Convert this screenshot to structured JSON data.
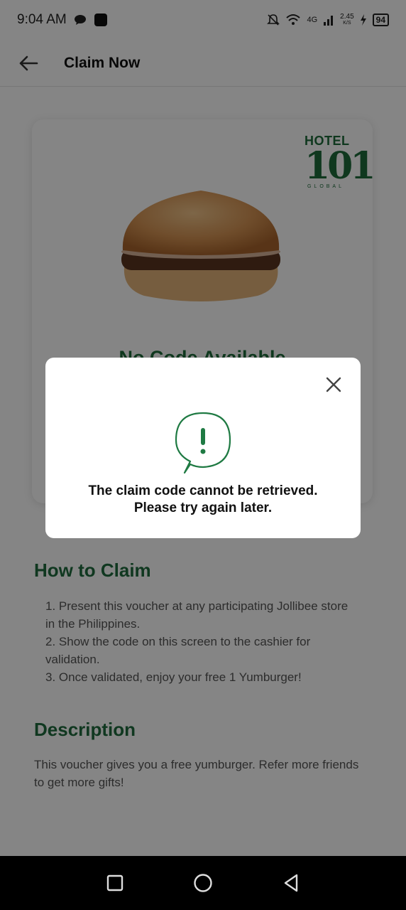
{
  "status_bar": {
    "time": "9:04 AM",
    "network": "4G",
    "speed_value": "2.45",
    "speed_unit": "K/S",
    "battery": "94"
  },
  "app_bar": {
    "title": "Claim Now",
    "back_icon": "arrow-left-icon"
  },
  "voucher": {
    "logo_top": "HOTEL",
    "logo_mid": "101",
    "logo_bottom": "GLOBAL",
    "code_status": "No Code Available"
  },
  "how_to_claim": {
    "title": "How to Claim",
    "steps": [
      "1. Present this voucher at any participating Jollibee store in the Philippines.",
      "2. Show the code on this screen to the cashier for validation.",
      "3. Once validated, enjoy your free 1 Yumburger!"
    ]
  },
  "description": {
    "title": "Description",
    "text": "This voucher gives you a free yumburger. Refer more friends to get more gifts!"
  },
  "dialog": {
    "message_line1": "The claim code cannot be retrieved.",
    "message_line2": "Please try again later.",
    "icon": "alert-bubble-icon",
    "accent_color": "#1f7a43"
  },
  "nav_bar": {
    "recents_icon": "square-icon",
    "home_icon": "circle-icon",
    "back_icon": "triangle-back-icon"
  }
}
